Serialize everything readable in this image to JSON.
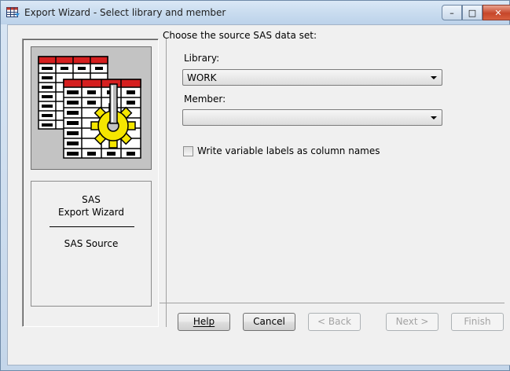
{
  "window": {
    "title": "Export Wizard - Select library and member",
    "minimize_glyph": "–",
    "maximize_glyph": "□",
    "close_glyph": "✕"
  },
  "left_panel": {
    "wizard_title_line1": "SAS",
    "wizard_title_line2": "Export Wizard",
    "step": "SAS Source"
  },
  "form": {
    "prompt": "Choose the source SAS data set:",
    "library_label": "Library:",
    "library_value": "WORK",
    "member_label": "Member:",
    "member_value": "",
    "checkbox_label": "Write variable labels as column names",
    "checkbox_checked": false
  },
  "buttons": {
    "help": "Help",
    "cancel": "Cancel",
    "back": "< Back",
    "next": "Next >",
    "finish": "Finish"
  },
  "colors": {
    "close_button": "#c6462a",
    "table_header": "#d51f1f",
    "gear": "#f5e600"
  }
}
